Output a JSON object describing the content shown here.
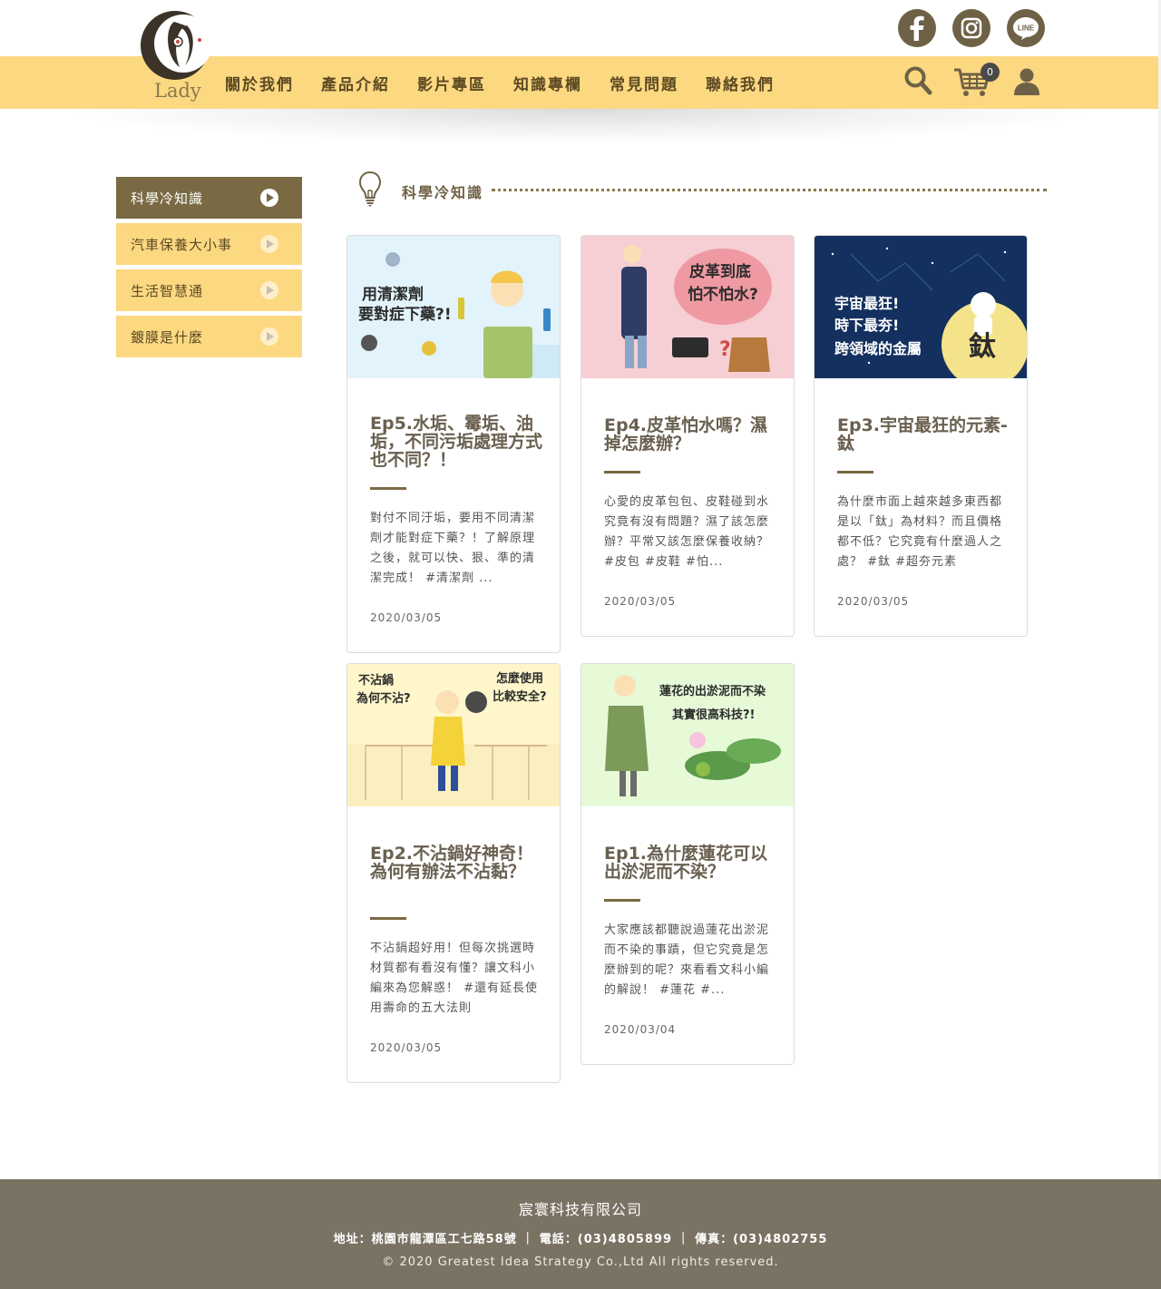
{
  "brand": {
    "logo_text": "Lady"
  },
  "nav": {
    "items": [
      "關於我們",
      "產品介紹",
      "影片專區",
      "知識專欄",
      "常見問題",
      "聯絡我們"
    ]
  },
  "social": {
    "line_label": "LINE"
  },
  "cart": {
    "count": "0"
  },
  "sidebar": {
    "items": [
      {
        "label": "科學冷知識",
        "active": true
      },
      {
        "label": "汽車保養大小事",
        "active": false
      },
      {
        "label": "生活智慧通",
        "active": false
      },
      {
        "label": "鍍膜是什麼",
        "active": false
      }
    ]
  },
  "section": {
    "title": "科學冷知識"
  },
  "cards": [
    {
      "title": "Ep5.水垢、霉垢、油垢，不同污垢處理方式也不同？！",
      "desc": "對付不同汙垢，要用不同清潔劑才能對症下藥？！了解原理之後，就可以快、狠、準的清潔完成！ #清潔劑 ...",
      "date": "2020/03/05",
      "image_text": "用清潔劑要對症下藥?!"
    },
    {
      "title": "Ep4.皮革怕水嗎？濕掉怎麼辦？",
      "desc": "心愛的皮革包包、皮鞋碰到水究竟有沒有問題？濕了該怎麼辦？平常又該怎麼保養收納？ #皮包 #皮鞋 #怕...",
      "date": "2020/03/05",
      "image_text": "皮革到底怕不怕水?"
    },
    {
      "title": "Ep3.宇宙最狂的元素-鈦",
      "desc": "為什麼市面上越來越多東西都是以「鈦」為材料？而且價格都不低？它究竟有什麼過人之處？ #鈦 #超夯元素",
      "date": "2020/03/05",
      "image_text": "宇宙最狂！時下最夯！跨領域的金屬 鈦"
    },
    {
      "title": "Ep2.不沾鍋好神奇！為何有辦法不沾黏？",
      "desc": "不沾鍋超好用！但每次挑選時材質都有看沒有懂？讓文科小編來為您解惑！ #還有延長使用壽命的五大法則",
      "date": "2020/03/05",
      "image_text": "不沾鍋為何不沾? 怎麼使用比較安全?"
    },
    {
      "title": "Ep1.為什麼蓮花可以出淤泥而不染？",
      "desc": "大家應該都聽說過蓮花出淤泥而不染的事蹟，但它究竟是怎麼辦到的呢？來看看文科小編的解說！ #蓮花 #...",
      "date": "2020/03/04",
      "image_text": "蓮花的出淤泥而不染 其實很高科技?!"
    }
  ],
  "footer": {
    "company": "宸寰科技有限公司",
    "address": "地址：桃園市龍潭區工七路58號 ｜ 電話：(03)4805899 ｜ 傳真：(03)4802755",
    "copyright": "© 2020 Greatest Idea Strategy Co.,Ltd All rights reserved."
  },
  "colors": {
    "nav_bg": "#fcd881",
    "accent_dark": "#7a6a43",
    "footer_bg": "#7a7263"
  },
  "icons": [
    "facebook-icon",
    "instagram-icon",
    "line-icon",
    "search-icon",
    "cart-icon",
    "user-icon",
    "lightbulb-icon",
    "play-icon"
  ]
}
